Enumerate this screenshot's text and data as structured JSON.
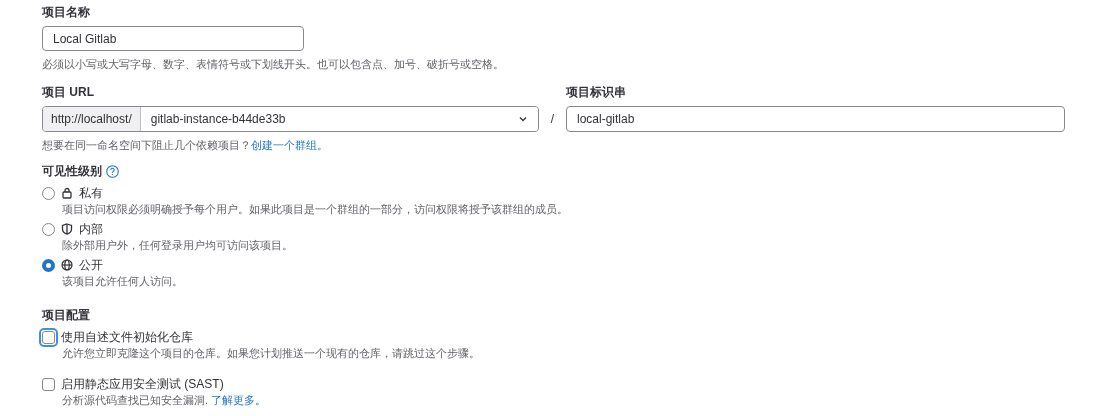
{
  "project_name": {
    "label": "项目名称",
    "value": "Local Gitlab",
    "help": "必须以小写或大写字母、数字、表情符号或下划线开头。也可以包含点、加号、破折号或空格。"
  },
  "project_url": {
    "label": "项目 URL",
    "prefix": "http://localhost/",
    "namespace": "gitlab-instance-b44de33b",
    "separator": "/",
    "help": "想要在同一命名空间下阻止几个依赖项目？",
    "help_link": "创建一个群组。"
  },
  "project_slug": {
    "label": "项目标识串",
    "value": "local-gitlab"
  },
  "visibility": {
    "label": "可见性级别",
    "options": [
      {
        "kind": "lock",
        "label": "私有",
        "description": "项目访问权限必须明确授予每个用户。如果此项目是一个群组的一部分，访问权限将授予该群组的成员。",
        "selected": false
      },
      {
        "kind": "shield",
        "label": "内部",
        "description": "除外部用户外，任何登录用户均可访问该项目。",
        "selected": false
      },
      {
        "kind": "globe",
        "label": "公开",
        "description": "该项目允许任何人访问。",
        "selected": true
      }
    ]
  },
  "configuration": {
    "label": "项目配置",
    "options": [
      {
        "label": "使用自述文件初始化仓库",
        "description": "允许您立即克隆这个项目的仓库。如果您计划推送一个现有的仓库，请跳过这个步骤。",
        "checked": false,
        "focused": true
      },
      {
        "label": "启用静态应用安全测试 (SAST)",
        "description": "分析源代码查找已知安全漏洞.",
        "link": "了解更多。",
        "checked": false,
        "focused": false
      }
    ]
  }
}
